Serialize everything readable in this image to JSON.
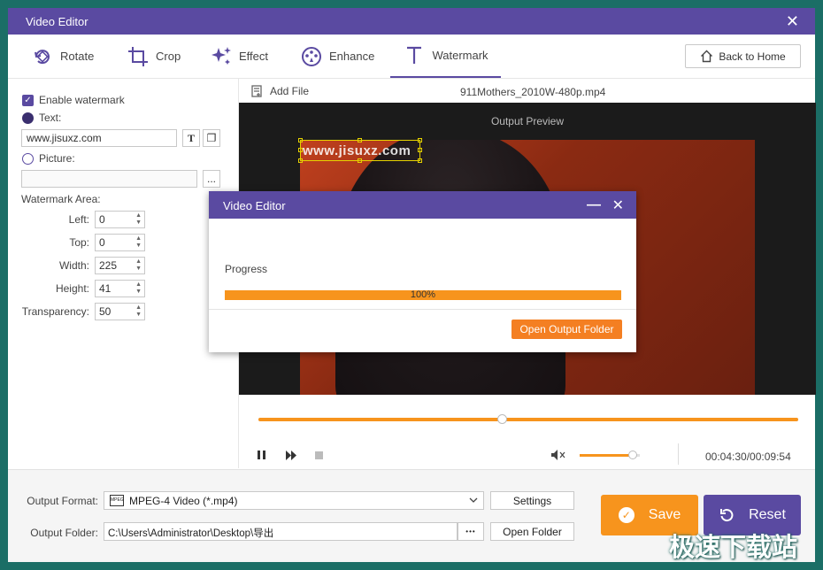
{
  "window": {
    "title": "Video Editor"
  },
  "toolbar": {
    "tabs": [
      {
        "label": "Rotate",
        "icon": "rotate-icon"
      },
      {
        "label": "Crop",
        "icon": "crop-icon"
      },
      {
        "label": "Effect",
        "icon": "effect-icon"
      },
      {
        "label": "Enhance",
        "icon": "enhance-icon"
      },
      {
        "label": "Watermark",
        "icon": "watermark-icon"
      }
    ],
    "active_tab": "Watermark",
    "back_label": "Back to Home"
  },
  "watermark": {
    "enable_label": "Enable watermark",
    "enabled": true,
    "text_label": "Text:",
    "text_value": "www.jisuxz.com",
    "picture_label": "Picture:",
    "picture_value": "",
    "browse_label": "...",
    "area_label": "Watermark Area:",
    "left_label": "Left:",
    "left_value": "0",
    "top_label": "Top:",
    "top_value": "0",
    "width_label": "Width:",
    "width_value": "225",
    "height_label": "Height:",
    "height_value": "41",
    "transparency_label": "Transparency:",
    "transparency_value": "50",
    "overlay_text": "www.jisuxz.com"
  },
  "preview": {
    "add_file_label": "Add File",
    "file_name": "911Mothers_2010W-480p.mp4",
    "output_label": "Output Preview",
    "seek_fraction": 0.45,
    "volume_fraction": 0.88,
    "time": "00:04:30/00:09:54"
  },
  "dialog": {
    "title": "Video Editor",
    "progress_label": "Progress",
    "progress_value": "100%",
    "progress_fraction": 1.0,
    "open_output_label": "Open Output Folder"
  },
  "bottom": {
    "format_label": "Output Format:",
    "format_value": "MPEG-4 Video (*.mp4)",
    "settings_label": "Settings",
    "folder_label": "Output Folder:",
    "folder_value": "C:\\Users\\Administrator\\Desktop\\导出",
    "folder_dots": "•••",
    "open_folder_label": "Open Folder",
    "save_label": "Save",
    "reset_label": "Reset"
  },
  "colors": {
    "accent": "#5a4aa1",
    "orange": "#f7941d",
    "save": "#f7941d",
    "reset": "#5a4aa1"
  },
  "watermark_site": "极速下载站"
}
